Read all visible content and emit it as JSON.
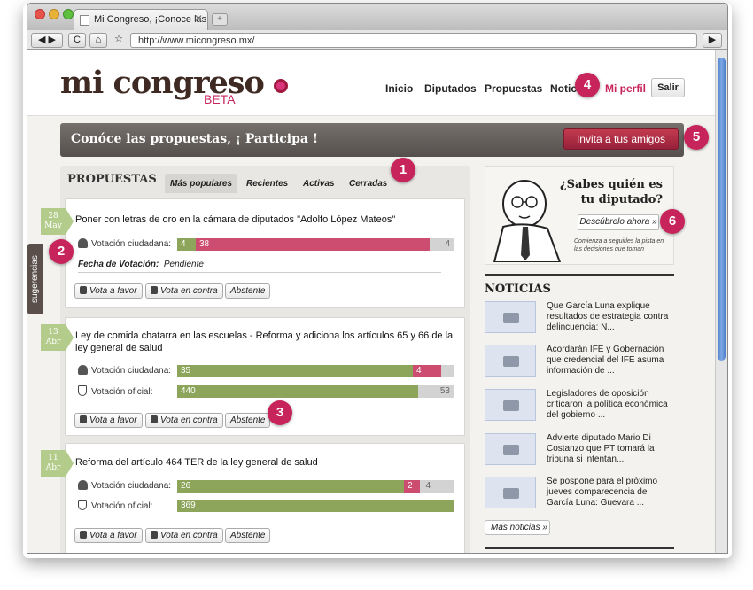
{
  "browser": {
    "tab_title": "Mi Congreso, ¡Conoce las pr",
    "tab_close": "✕",
    "new_tab": "+",
    "url": "http://www.micongreso.mx/",
    "back": "◀",
    "forward": "▶",
    "reload": "C",
    "home": "⌂",
    "star": "☆",
    "go": "▶"
  },
  "header": {
    "logo_text": "mi congreso",
    "logo_badge": "BETA",
    "nav": [
      "Inicio",
      "Diputados",
      "Propuestas",
      "Notic"
    ],
    "mi_perfil": "Mi perfil",
    "salir": "Salir"
  },
  "banner": {
    "text": "Conóce las propuestas,   ¡ Participa !",
    "invite_button": "Invita a tus amigos"
  },
  "propuestas": {
    "heading": "PROPUESTAS",
    "tabs": [
      "Más populares",
      "Recientes",
      "Activas",
      "Cerradas"
    ],
    "items": [
      {
        "day": "28",
        "month": "May",
        "title": "Poner con letras de oro en la cámara de diputados \"Adolfo López Mateos\"",
        "ciudadana_label": "Votación ciudadana:",
        "ciudadana": {
          "favor": 4,
          "contra": 38,
          "abstencion": 4
        },
        "fecha_label": "Fecha de Votación:",
        "fecha_value": "Pendiente",
        "buttons": [
          "Vota a favor",
          "Vota en contra",
          "Abstente"
        ]
      },
      {
        "day": "13",
        "month": "Abr",
        "title": "Ley de comida chatarra en las escuelas - Reforma y adiciona los artículos 65 y 66 de la ley general de salud",
        "ciudadana_label": "Votación ciudadana:",
        "ciudadana": {
          "favor": 35,
          "contra": 4
        },
        "oficial_label": "Votación oficial:",
        "oficial": {
          "favor": 440,
          "abstencion": 53
        },
        "buttons": [
          "Vota a favor",
          "Vota en contra",
          "Abstente"
        ]
      },
      {
        "day": "11",
        "month": "Abr",
        "title": "Reforma del artículo 464 TER de la ley general de salud",
        "ciudadana_label": "Votación ciudadana:",
        "ciudadana": {
          "favor": 26,
          "contra": 2,
          "abstencion": 4
        },
        "oficial_label": "Votación oficial:",
        "oficial": {
          "favor": 369
        },
        "buttons": [
          "Vota a favor",
          "Vota en contra",
          "Abstente"
        ]
      }
    ]
  },
  "sugerencias": "sugerencias",
  "ad": {
    "question": "¿Sabes quién es tu diputado?",
    "button": "Descúbrelo ahora »",
    "small": "Comienza a seguirles la pista en las decisiones que toman"
  },
  "noticias": {
    "heading": "NOTICIAS",
    "items": [
      "Que García Luna explique resultados de estrategia contra delincuencia: N...",
      "Acordarán IFE y Gobernación que credencial del IFE asuma información de ...",
      "Legisladores de oposición criticaron la política económica del gobierno ...",
      "Advierte diputado Mario Di Costanzo que PT tomará la tribuna si intentan...",
      "Se pospone para el próximo jueves comparecencia de García Luna: Guevara ..."
    ],
    "more": "Mas noticias »"
  },
  "callouts": [
    "1",
    "2",
    "3",
    "4",
    "5",
    "6"
  ],
  "colors": {
    "brand": "#c8245c",
    "green": "#8ca55a",
    "red": "#cc4d70",
    "banner": "#5e5855"
  }
}
